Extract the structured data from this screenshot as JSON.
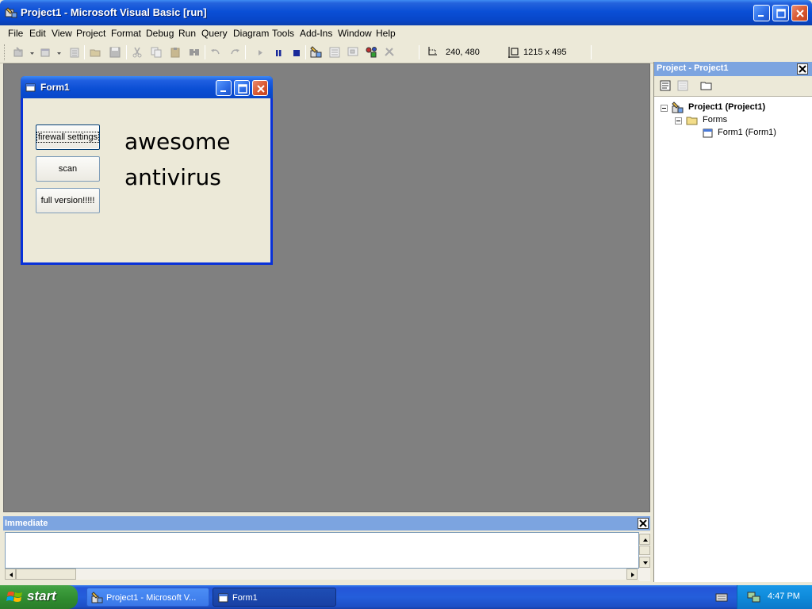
{
  "window": {
    "title": "Project1 - Microsoft Visual Basic [run]"
  },
  "menu": [
    "File",
    "Edit",
    "View",
    "Project",
    "Format",
    "Debug",
    "Run",
    "Query",
    "Diagram",
    "Tools",
    "Add-Ins",
    "Window",
    "Help"
  ],
  "toolbar": {
    "position_readout": "240, 480",
    "size_readout": "1215 x 495"
  },
  "form1": {
    "title": "Form1",
    "buttons": {
      "firewall": "firewall settings",
      "scan": "scan",
      "full": "full version!!!!!"
    },
    "label_line1": "awesome",
    "label_line2": "antivirus"
  },
  "project_pane": {
    "title": "Project - Project1",
    "tree": {
      "root": "Project1 (Project1)",
      "folder": "Forms",
      "item": "Form1 (Form1)"
    }
  },
  "immediate": {
    "title": "Immediate"
  },
  "taskbar": {
    "start_label": "start",
    "tasks": [
      "Project1 - Microsoft V...",
      "Form1"
    ],
    "clock": "4:47 PM"
  },
  "colors": {
    "title_blue": "#0a4fd6",
    "workspace_gray": "#808080",
    "pane_header": "#7ca4e0",
    "start_green": "#3c9b3c"
  }
}
